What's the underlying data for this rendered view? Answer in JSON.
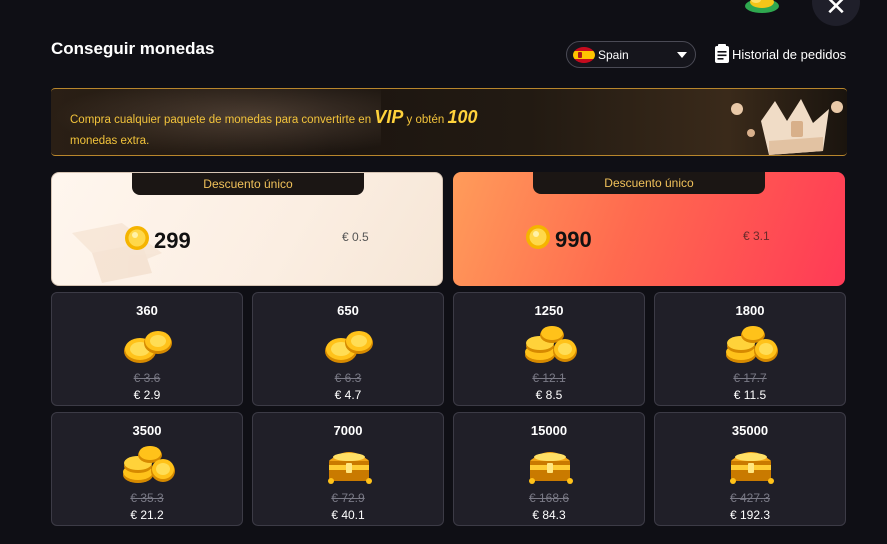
{
  "header": {
    "title": "Conseguir monedas",
    "close_icon": "close-icon",
    "region": {
      "label": "Spain",
      "flag_icon": "spain-flag-icon"
    },
    "history_label": "Historial de pedidos"
  },
  "banner": {
    "text_before": "Compra cualquier paquete de monedas para convertirte en",
    "vip": "VIP",
    "text_middle": "y obtén",
    "bonus": "100",
    "text_after": "monedas extra.",
    "accent_color": "#f2c33b"
  },
  "featured": [
    {
      "tag": "Descuento único",
      "amount": "299",
      "price": "€ 0.5"
    },
    {
      "tag": "Descuento único",
      "amount": "990",
      "price": "€ 3.1"
    }
  ],
  "packages": [
    {
      "amount": "360",
      "old_price": "€ 3.6",
      "price": "€ 2.9",
      "icon": "coins-small-icon"
    },
    {
      "amount": "650",
      "old_price": "€ 6.3",
      "price": "€ 4.7",
      "icon": "coins-small-icon"
    },
    {
      "amount": "1250",
      "old_price": "€ 12.1",
      "price": "€ 8.5",
      "icon": "coin-stack-icon"
    },
    {
      "amount": "1800",
      "old_price": "€ 17.7",
      "price": "€ 11.5",
      "icon": "coin-stack-icon"
    },
    {
      "amount": "3500",
      "old_price": "€ 35.3",
      "price": "€ 21.2",
      "icon": "coin-stack-icon"
    },
    {
      "amount": "7000",
      "old_price": "€ 72.9",
      "price": "€ 40.1",
      "icon": "treasure-chest-icon"
    },
    {
      "amount": "15000",
      "old_price": "€ 168.6",
      "price": "€ 84.3",
      "icon": "treasure-chest-icon"
    },
    {
      "amount": "35000",
      "old_price": "€ 427.3",
      "price": "€ 192.3",
      "icon": "treasure-chest-icon"
    }
  ]
}
